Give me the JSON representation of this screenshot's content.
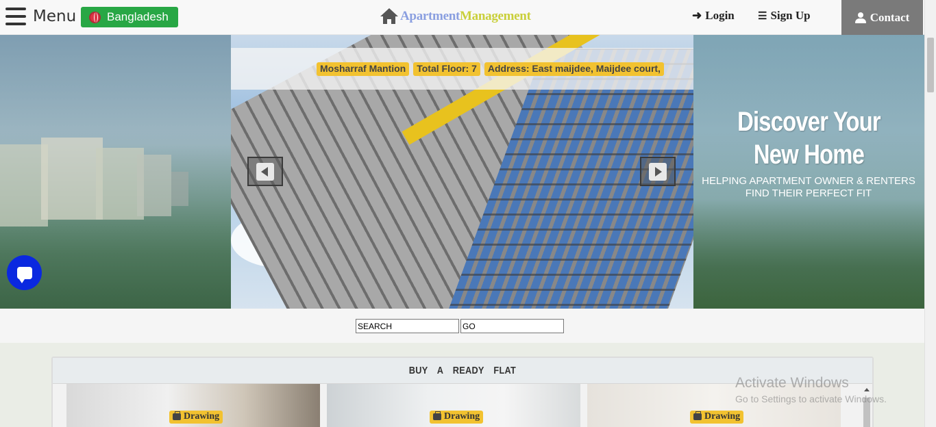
{
  "header": {
    "menu_label": "Menu",
    "country": "Bangladesh",
    "brand_part1": "Apartment",
    "brand_part2": "Management",
    "login": "Login",
    "signup": "Sign Up",
    "contact": "Contact"
  },
  "slider": {
    "badges": [
      "Mosharraf Mantion",
      "Total Floor: 7",
      "Address: East maijdee, Maijdee court,"
    ]
  },
  "hero": {
    "title": "Discover Your New Home",
    "subtitle": "HELPING APARTMENT OWNER & RENTERS FIND THEIR PERFECT FIT"
  },
  "search": {
    "search_value": "SEARCH",
    "go_value": "GO"
  },
  "section": {
    "title": "BUY A READY FLAT",
    "cards": [
      {
        "tag": "Drawing"
      },
      {
        "tag": "Drawing"
      },
      {
        "tag": "Drawing"
      }
    ]
  },
  "watermark": {
    "title": "Activate Windows",
    "subtitle": "Go to Settings to activate Windows."
  },
  "colors": {
    "country_button": "#28a745",
    "badge": "#f2c230",
    "chat_button": "#0a28e0",
    "contact_button": "#7a7a7a"
  }
}
